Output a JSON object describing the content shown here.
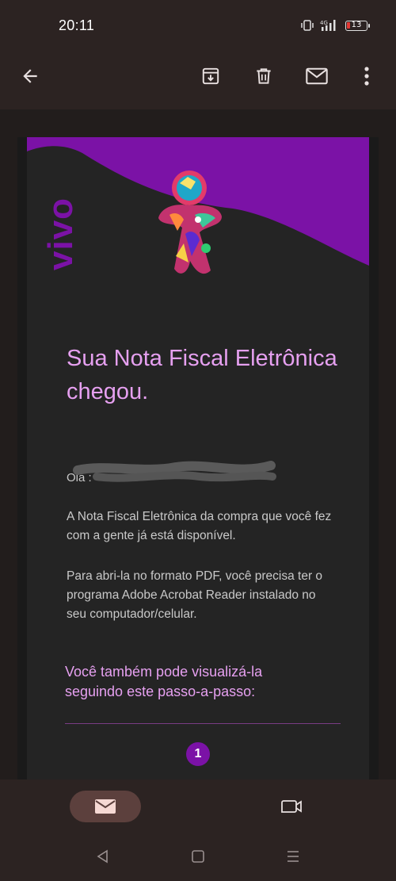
{
  "status_bar": {
    "time": "20:11",
    "network": "4G",
    "battery": "13"
  },
  "app_bar": {
    "icons": [
      "back-arrow-icon",
      "archive-download-icon",
      "trash-icon",
      "mail-icon",
      "more-vert-icon"
    ]
  },
  "email": {
    "brand": "vivo",
    "title": "Sua Nota Fiscal Eletrônica chegou.",
    "greeting": "Ola :",
    "paragraph1": "A Nota Fiscal Eletrônica da compra que você fez com a gente já está disponível.",
    "paragraph2": "Para abri-la no formato PDF, você precisa ter o programa Adobe Acrobat Reader instalado no seu computador/celular.",
    "subtitle": "Você também pode visualizá-la seguindo este passo-a-passo:",
    "step_number": "1"
  },
  "colors": {
    "accent_purple": "#7b12a6",
    "title_pink": "#e6a0f0",
    "active_nav_bg": "#5c403d"
  },
  "bottom_nav": {
    "items": [
      "mail-icon",
      "video-camera-icon"
    ],
    "active": "mail-icon"
  }
}
